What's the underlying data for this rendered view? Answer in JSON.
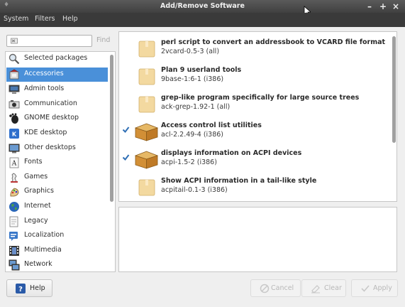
{
  "window": {
    "title": "Add/Remove Software",
    "controls": [
      "minimize-icon",
      "maximize-icon",
      "close-icon"
    ]
  },
  "menubar": {
    "items": [
      "System",
      "Filters",
      "Help"
    ]
  },
  "search": {
    "value": "",
    "placeholder": "",
    "find_label": "Find"
  },
  "sidebar": {
    "selected_index": 1,
    "items": [
      {
        "label": "Selected packages",
        "icon": "search-icon"
      },
      {
        "label": "Accessories",
        "icon": "accessories-icon"
      },
      {
        "label": "Admin tools",
        "icon": "admin-tools-icon"
      },
      {
        "label": "Communication",
        "icon": "communication-icon"
      },
      {
        "label": "GNOME desktop",
        "icon": "gnome-icon"
      },
      {
        "label": "KDE desktop",
        "icon": "kde-icon"
      },
      {
        "label": "Other desktops",
        "icon": "desktop-icon"
      },
      {
        "label": "Fonts",
        "icon": "fonts-icon"
      },
      {
        "label": "Games",
        "icon": "games-icon"
      },
      {
        "label": "Graphics",
        "icon": "graphics-icon"
      },
      {
        "label": "Internet",
        "icon": "internet-icon"
      },
      {
        "label": "Legacy",
        "icon": "legacy-icon"
      },
      {
        "label": "Localization",
        "icon": "localization-icon"
      },
      {
        "label": "Multimedia",
        "icon": "multimedia-icon"
      },
      {
        "label": "Network",
        "icon": "network-icon"
      }
    ]
  },
  "packages": [
    {
      "name": "perl script to convert an addressbook to VCARD file format",
      "version": "2vcard-0.5-3 (all)",
      "installed": false
    },
    {
      "name": "Plan 9 userland tools",
      "version": "9base-1:6-1 (i386)",
      "installed": false
    },
    {
      "name": "grep-like program specifically for large source trees",
      "version": "ack-grep-1.92-1 (all)",
      "installed": false
    },
    {
      "name": "Access control list utilities",
      "version": "acl-2.2.49-4 (i386)",
      "installed": true
    },
    {
      "name": "displays information on ACPI devices",
      "version": "acpi-1.5-2 (i386)",
      "installed": true
    },
    {
      "name": "Show ACPI information in a tail-like style",
      "version": "acpitail-0.1-3 (i386)",
      "installed": false
    }
  ],
  "buttons": {
    "help": "Help",
    "cancel": "Cancel",
    "clear": "Clear",
    "apply": "Apply"
  },
  "colors": {
    "selection": "#4a90d9",
    "titlebar": "#404040",
    "check": "#2f6fb5",
    "package_box": "#f3d9a0",
    "package_box_installed": "#d79a3c"
  }
}
